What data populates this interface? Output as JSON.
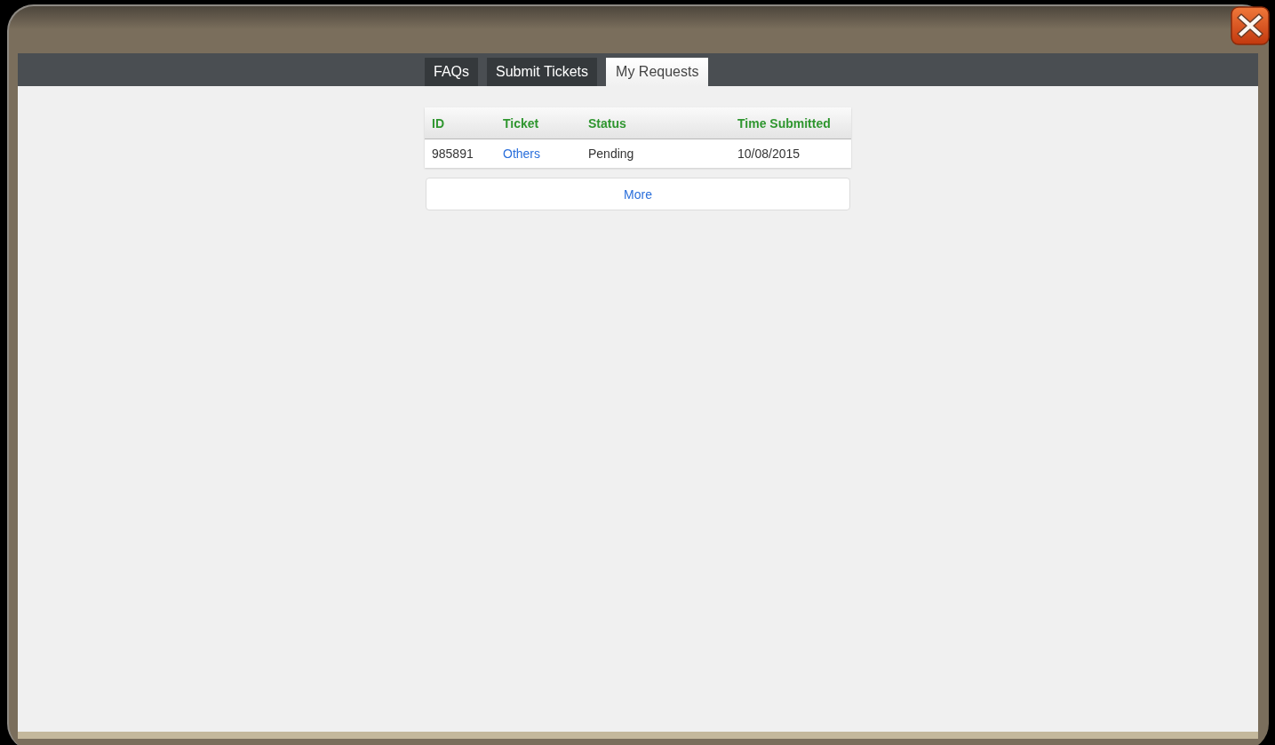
{
  "tabs": [
    {
      "label": "FAQs",
      "selected": false
    },
    {
      "label": "Submit Tickets",
      "selected": false
    },
    {
      "label": "My Requests",
      "selected": true
    }
  ],
  "table": {
    "columns": [
      "ID",
      "Ticket",
      "Status",
      "Time Submitted"
    ],
    "rows": [
      {
        "id": "985891",
        "ticket": "Others",
        "status": "Pending",
        "time_submitted": "10/08/2015"
      }
    ]
  },
  "more_button": {
    "label": "More"
  }
}
